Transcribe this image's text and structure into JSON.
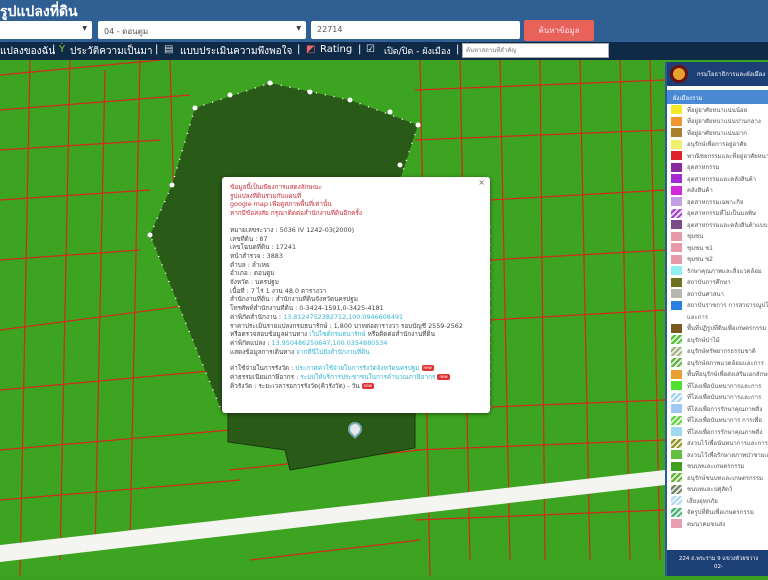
{
  "header": {
    "title": "รูปแปลงที่ดิน",
    "province_select": "",
    "district_select": "04 - ดอนตูม",
    "parcel_input": "22714",
    "search_label": "ค้นหาข้อมูล"
  },
  "toolbar": {
    "my_parcels": "แปลงของฉัน",
    "history": "ประวัติความเป็นมา",
    "survey": "แบบประเมินความพึงพอใจ",
    "rating": "Rating",
    "toggle_plan": "เปิด/ปิด - ผังเมือง",
    "place_placeholder": "ค้นหาสถานที่สำคัญ"
  },
  "popup": {
    "warning": [
      "ข้อมูลนี้เป็นเพียงการแสดงลักษณะ",
      "รูปแปลงที่ดินร่วมกับแผนที่",
      "google map เพื่อดูสภาพพื้นที่เท่านั้น",
      "หากมีข้อสงสัย กรุณาติดต่อสำนักงานที่ดินอีกครั้ง"
    ],
    "sheet": "หมายเลขระวาง : 5036 IV 1242-03(2000)",
    "parcel_no": "เลขที่ดิน : 87",
    "deed_no": "เลขโฉนดที่ดิน : 17241",
    "survey_page": "หน้าสำรวจ : 3883",
    "subdistrict": "ตำบล : ลำเหย",
    "district": "อำเภอ : ดอนตูม",
    "province": "จังหวัด : นครปฐม",
    "area": "เนื้อที่ : 7 ไร่ 1 งาน 48.0 ตารางวา",
    "office": "สำนักงานที่ดิน : สำนักงานที่ดินจังหวัดนครปฐม",
    "phone": "โทรศัพท์สำนักงานที่ดิน : 0-3424-1591,0-3425-4181",
    "office_coord_label": "ค่าพิกัดสำนักงาน : ",
    "office_coord": "13.8124752382712,100.0946608491",
    "price": "ราคาประเมินรายแปลงกรมธนารักษ์ : 1,800 บาทต่อตารางวา รอบบัญชี 2559-2562",
    "check_prefix": "หรือตรวจสอบข้อมูลผ่านทาง ",
    "check_link": "เว็บไซต์กรมธนารักษ์",
    "check_suffix": " หรือติดต่อสำนักงานที่ดิน",
    "parcel_coord_label": "ค่าพิกัดแปลง : ",
    "parcel_coord": "13.950486250647,100.0354880534",
    "route_label": "แสดงข้อมูลการเดินทาง ",
    "route_link": "จากที่นี่ไปยังสำนักงานที่ดิน",
    "fee_label": "ค่าใช้จ่ายในการรังวัด : ",
    "fee_link": "ประกาศค่าใช้จ่ายในการรังวัดจังหวัดนครปฐม",
    "tax_label": "ค่าธรรมเนียมภาษีอากร : ",
    "tax_link": "ระบบให้บริการประชาชนในการคำนวณภาษีอากร",
    "queue": "คิวรังวัด : ระยะเวลารอการรังวัด(คิวรังวัด) - วัน",
    "new_badge": "new"
  },
  "legend": {
    "header": "กรมโยธาธิการและผังเมือง",
    "subtitle": "ผังเมืองรวม",
    "items": [
      {
        "label": "ที่อยู่อาศัยหนาแน่นน้อย",
        "color": "#f5e829"
      },
      {
        "label": "ที่อยู่อาศัยหนาแน่นปานกลาง",
        "color": "#f0962c"
      },
      {
        "label": "ที่อยู่อาศัยหนาแน่นมาก",
        "color": "#a9802c"
      },
      {
        "label": "อนุรักษ์เพื่อการอยู่อาศัย",
        "color": "#f0f070"
      },
      {
        "label": "พาณิชยกรรมและที่อยู่อาศัยหนาแน่นมาก",
        "color": "#e0202a"
      },
      {
        "label": "อุตสาหกรรม",
        "color": "#8a2aa0"
      },
      {
        "label": "อุตสาหกรรมและคลังสินค้า",
        "color": "#a22ad0"
      },
      {
        "label": "คลังสินค้า",
        "color": "#d02ad8"
      },
      {
        "label": "อุตสาหกรรมเฉพาะกิจ",
        "color": "#c0a0e0"
      },
      {
        "label": "อุตสาหกรรมที่ไม่เป็นมลพิษ",
        "color": "#a040d0",
        "hatch": true
      },
      {
        "label": "อุตสาหกรรมและคลังสินค้าแบบ",
        "color": "#7a4a8a"
      },
      {
        "label": "ชุมชน",
        "color": "#e89aa8"
      },
      {
        "label": "ชุมชน ช1",
        "color": "#e89aa8"
      },
      {
        "label": "ชุมชน ช2",
        "color": "#e89aa8"
      },
      {
        "label": "รักษาคุณภาพและสิ่งแวดล้อม",
        "color": "#90f0f0"
      },
      {
        "label": "สถาบันการศึกษา",
        "color": "#707020"
      },
      {
        "label": "สถาบันศาสนา",
        "color": "#b8b8b0"
      },
      {
        "label": "สถาบันราชการ การสาธารณูปโภค",
        "color": "#2a80e0"
      },
      {
        "label": "และการ",
        "color": "#ffffff"
      },
      {
        "label": "พื้นที่ปฏิรูปที่ดินเพื่อเกษตรกรรม",
        "color": "#7a5a20"
      },
      {
        "label": "อนุรักษ์ป่าไม้",
        "color": "#50c030",
        "hatch": true
      },
      {
        "label": "อนุรักษ์ทรัพยากรธรรมชาติ",
        "color": "#a0b080",
        "hatch": true
      },
      {
        "label": "อนุรักษ์สภาพแวดล้อมและการ",
        "color": "#60b040",
        "hatch": true
      },
      {
        "label": "พื้นที่อนุรักษ์เพื่อส่งเสริมเอกลักษณ์",
        "color": "#e8a030"
      },
      {
        "label": "ที่โล่งเพื่อนันทนาการและการ",
        "color": "#50e030"
      },
      {
        "label": "ที่โล่งเพื่อนันทนาการและการ",
        "color": "#a0d0f0",
        "hatch": true
      },
      {
        "label": "ที่โล่งเพื่อการรักษาคุณภาพสิ่ง",
        "color": "#a0c8f0"
      },
      {
        "label": "ที่โล่งเพื่อนันทนาการ การเพื่อ",
        "color": "#60d040",
        "hatch": true
      },
      {
        "label": "ที่โล่งเพื่อการรักษาคุณภาพสิ่ง",
        "color": "#a0d8f0"
      },
      {
        "label": "สงวนไว้เพื่อนันทนาการและการ",
        "color": "#909020",
        "hatch": true
      },
      {
        "label": "สงวนไว้เพื่อรักษาสภาพป่าชายเลน",
        "color": "#60c040"
      },
      {
        "label": "ชนบทและเกษตรกรรม",
        "color": "#40a020"
      },
      {
        "label": "อนุรักษ์ชนบทและเกษตรกรรม",
        "color": "#60b030",
        "hatch": true
      },
      {
        "label": "ชนบทและปศุสัตว์",
        "color": "#708060",
        "hatch": true
      },
      {
        "label": "เสี่ยงอุทกภัย",
        "color": "#b0d8f0",
        "hatch": true
      },
      {
        "label": "จัดรูปที่ดินเพื่อเกษตรกรรม",
        "color": "#40b070",
        "hatch": true
      },
      {
        "label": "คมนาคมขนส่ง",
        "color": "#e8a0b0"
      }
    ],
    "footer": [
      "224 ถ.พระราม 9 แขวงห้วยขวาง",
      "02-"
    ]
  }
}
